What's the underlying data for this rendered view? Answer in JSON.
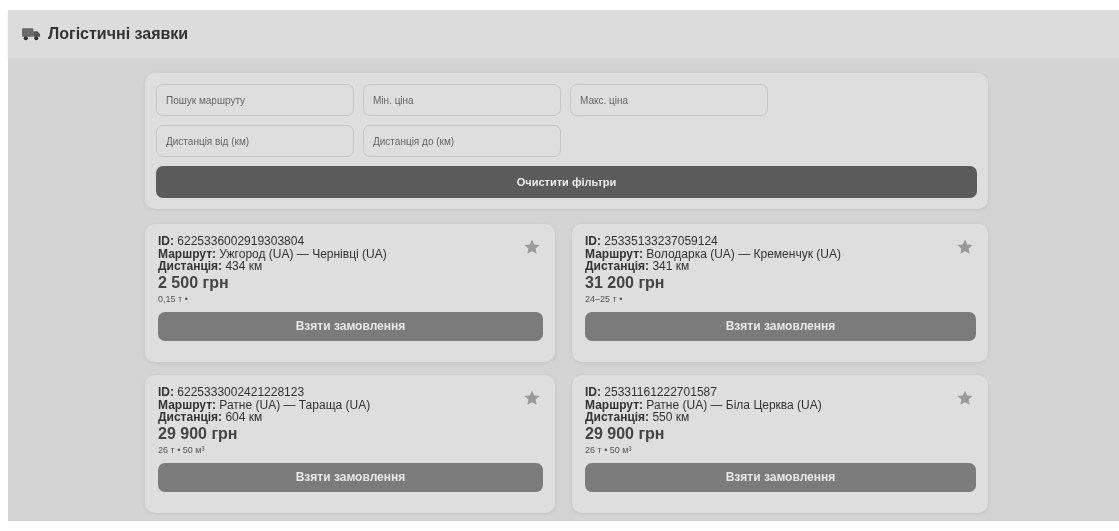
{
  "header": {
    "title": "Логістичні заявки"
  },
  "filters": {
    "fields": [
      {
        "placeholder": "Пошук маршруту"
      },
      {
        "placeholder": "Мін. ціна"
      },
      {
        "placeholder": "Макс. ціна"
      },
      {
        "placeholder": "Дистанція від (км)"
      },
      {
        "placeholder": "Дистанція до (км)"
      }
    ],
    "clear_button": "Очистити фільтри"
  },
  "orders": [
    {
      "id_label": "ID:",
      "id": "6225336002919303804",
      "route_label": "Маршрут:",
      "route": "Ужгород (UA) — Чернівці (UA)",
      "distance_label": "Дистанція:",
      "distance": "434 км",
      "price": "2 500 грн",
      "cargo": "0,15 т •",
      "favorite": false,
      "button": "Взяти замовлення"
    },
    {
      "id_label": "ID:",
      "id": "25335133237059124",
      "route_label": "Маршрут:",
      "route": "Володарка (UA) — Кременчук (UA)",
      "distance_label": "Дистанція:",
      "distance": "341 км",
      "price": "31 200 грн",
      "cargo": "24–25 т •",
      "favorite": false,
      "button": "Взяти замовлення"
    },
    {
      "id_label": "ID:",
      "id": "6225333002421228123",
      "route_label": "Маршрут:",
      "route": "Ратне (UA) — Тараща (UA)",
      "distance_label": "Дистанція:",
      "distance": "604 км",
      "price": "29 900 грн",
      "cargo": "26 т • 50 м³",
      "favorite": false,
      "button": "Взяти замовлення"
    },
    {
      "id_label": "ID:",
      "id": "25331161222701587",
      "route_label": "Маршрут:",
      "route": "Ратне (UA) — Біла Церква (UA)",
      "distance_label": "Дистанція:",
      "distance": "550 км",
      "price": "29 900 грн",
      "cargo": "26 т • 50 м³",
      "favorite": false,
      "button": "Взяти замовлення"
    }
  ]
}
